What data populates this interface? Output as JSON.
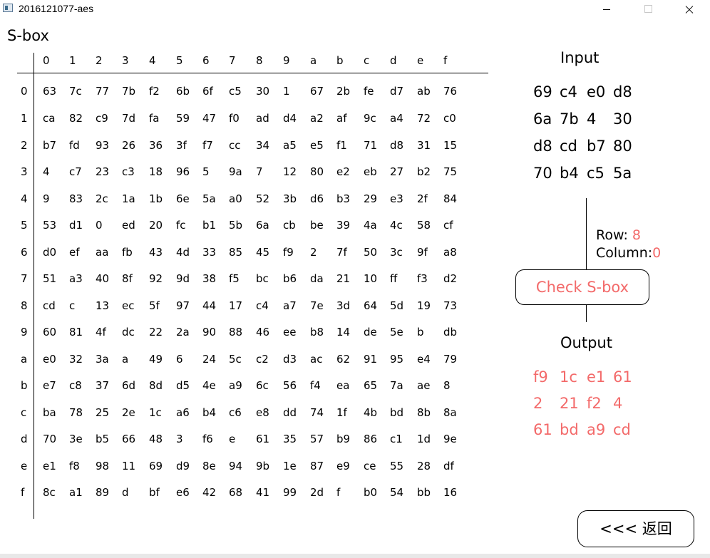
{
  "window": {
    "title": "2016121077-aes"
  },
  "sbox": {
    "title": "S-box",
    "col_headers": [
      "0",
      "1",
      "2",
      "3",
      "4",
      "5",
      "6",
      "7",
      "8",
      "9",
      "a",
      "b",
      "c",
      "d",
      "e",
      "f"
    ],
    "row_headers": [
      "0",
      "1",
      "2",
      "3",
      "4",
      "5",
      "6",
      "7",
      "8",
      "9",
      "a",
      "b",
      "c",
      "d",
      "e",
      "f"
    ],
    "rows": [
      [
        "63",
        "7c",
        "77",
        "7b",
        "f2",
        "6b",
        "6f",
        "c5",
        "30",
        "1",
        "67",
        "2b",
        "fe",
        "d7",
        "ab",
        "76"
      ],
      [
        "ca",
        "82",
        "c9",
        "7d",
        "fa",
        "59",
        "47",
        "f0",
        "ad",
        "d4",
        "a2",
        "af",
        "9c",
        "a4",
        "72",
        "c0"
      ],
      [
        "b7",
        "fd",
        "93",
        "26",
        "36",
        "3f",
        "f7",
        "cc",
        "34",
        "a5",
        "e5",
        "f1",
        "71",
        "d8",
        "31",
        "15"
      ],
      [
        "4",
        "c7",
        "23",
        "c3",
        "18",
        "96",
        "5",
        "9a",
        "7",
        "12",
        "80",
        "e2",
        "eb",
        "27",
        "b2",
        "75"
      ],
      [
        "9",
        "83",
        "2c",
        "1a",
        "1b",
        "6e",
        "5a",
        "a0",
        "52",
        "3b",
        "d6",
        "b3",
        "29",
        "e3",
        "2f",
        "84"
      ],
      [
        "53",
        "d1",
        "0",
        "ed",
        "20",
        "fc",
        "b1",
        "5b",
        "6a",
        "cb",
        "be",
        "39",
        "4a",
        "4c",
        "58",
        "cf"
      ],
      [
        "d0",
        "ef",
        "aa",
        "fb",
        "43",
        "4d",
        "33",
        "85",
        "45",
        "f9",
        "2",
        "7f",
        "50",
        "3c",
        "9f",
        "a8"
      ],
      [
        "51",
        "a3",
        "40",
        "8f",
        "92",
        "9d",
        "38",
        "f5",
        "bc",
        "b6",
        "da",
        "21",
        "10",
        "ff",
        "f3",
        "d2"
      ],
      [
        "cd",
        "c",
        "13",
        "ec",
        "5f",
        "97",
        "44",
        "17",
        "c4",
        "a7",
        "7e",
        "3d",
        "64",
        "5d",
        "19",
        "73"
      ],
      [
        "60",
        "81",
        "4f",
        "dc",
        "22",
        "2a",
        "90",
        "88",
        "46",
        "ee",
        "b8",
        "14",
        "de",
        "5e",
        "b",
        "db"
      ],
      [
        "e0",
        "32",
        "3a",
        "a",
        "49",
        "6",
        "24",
        "5c",
        "c2",
        "d3",
        "ac",
        "62",
        "91",
        "95",
        "e4",
        "79"
      ],
      [
        "e7",
        "c8",
        "37",
        "6d",
        "8d",
        "d5",
        "4e",
        "a9",
        "6c",
        "56",
        "f4",
        "ea",
        "65",
        "7a",
        "ae",
        "8"
      ],
      [
        "ba",
        "78",
        "25",
        "2e",
        "1c",
        "a6",
        "b4",
        "c6",
        "e8",
        "dd",
        "74",
        "1f",
        "4b",
        "bd",
        "8b",
        "8a"
      ],
      [
        "70",
        "3e",
        "b5",
        "66",
        "48",
        "3",
        "f6",
        "e",
        "61",
        "35",
        "57",
        "b9",
        "86",
        "c1",
        "1d",
        "9e"
      ],
      [
        "e1",
        "f8",
        "98",
        "11",
        "69",
        "d9",
        "8e",
        "94",
        "9b",
        "1e",
        "87",
        "e9",
        "ce",
        "55",
        "28",
        "df"
      ],
      [
        "8c",
        "a1",
        "89",
        "d",
        "bf",
        "e6",
        "42",
        "68",
        "41",
        "99",
        "2d",
        "f",
        "b0",
        "54",
        "bb",
        "16"
      ]
    ]
  },
  "input": {
    "title": "Input",
    "rows": [
      [
        "69",
        "c4",
        "e0",
        "d8"
      ],
      [
        "6a",
        "7b",
        "4",
        "30"
      ],
      [
        "d8",
        "cd",
        "b7",
        "80"
      ],
      [
        "70",
        "b4",
        "c5",
        "5a"
      ]
    ]
  },
  "lookup": {
    "row_label": "Row:",
    "row_value": "8",
    "column_label": "Column:",
    "column_value": "0",
    "check_button": "Check S-box"
  },
  "output": {
    "title": "Output",
    "rows": [
      [
        "f9",
        "1c",
        "e1",
        "61"
      ],
      [
        "2",
        "21",
        "f2",
        "4"
      ],
      [
        "61",
        "bd",
        "a9",
        "cd"
      ]
    ]
  },
  "nav": {
    "back_button": "<<< 返回"
  },
  "colors": {
    "accent": "#f36a6a"
  }
}
